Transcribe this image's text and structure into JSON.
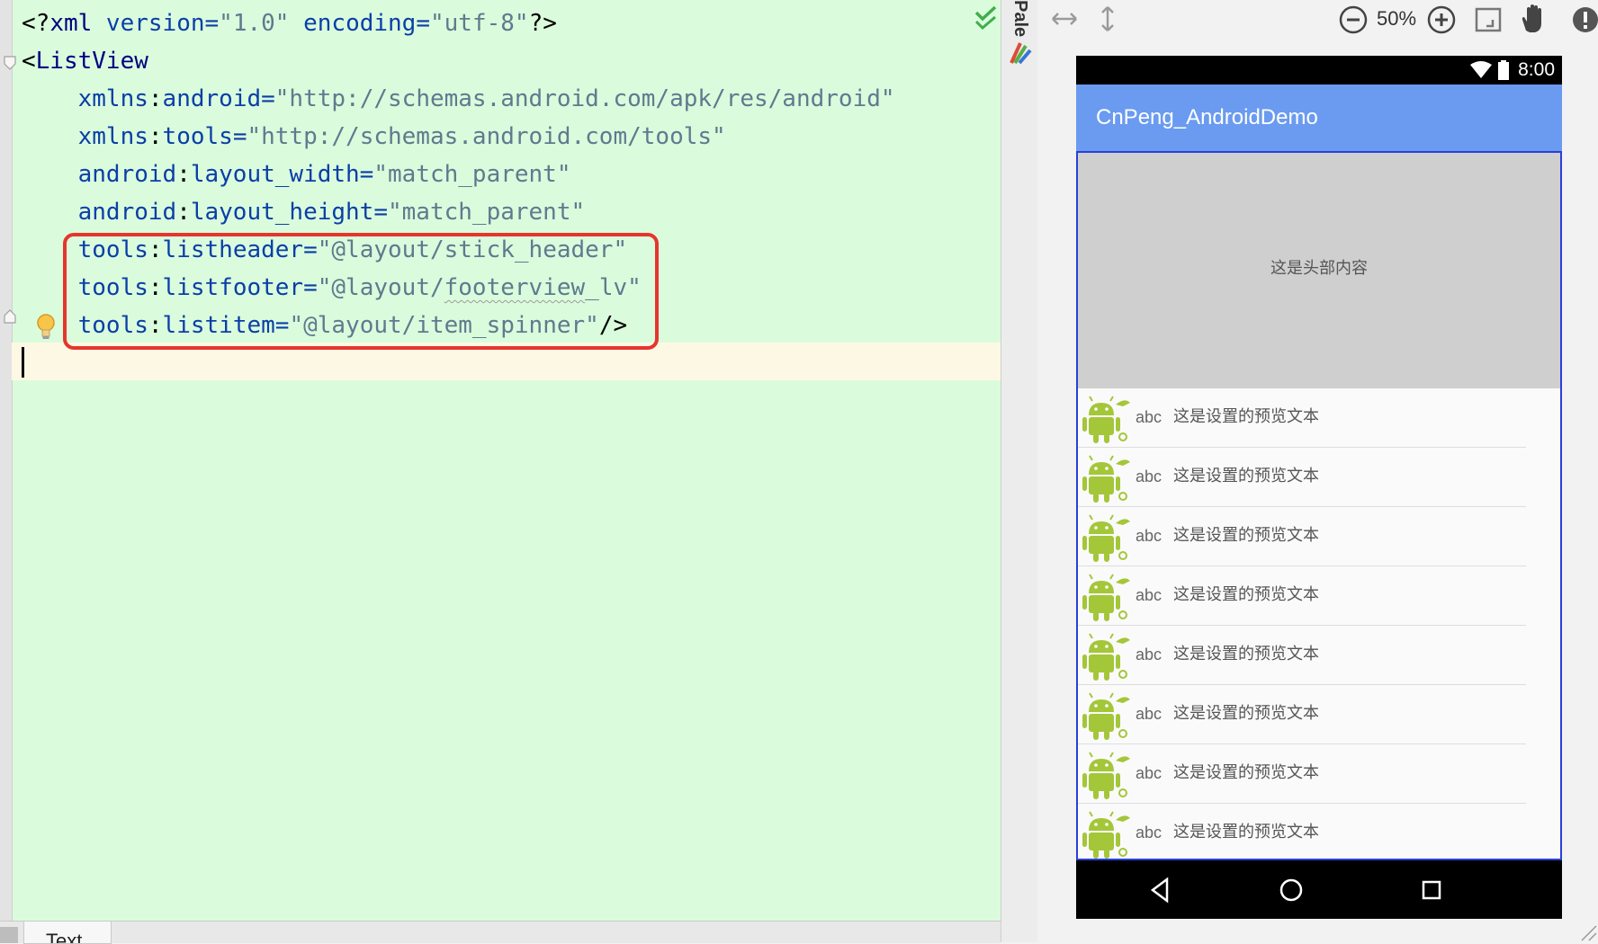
{
  "editor": {
    "lines": [
      [
        {
          "t": "<?",
          "c": "punc"
        },
        {
          "t": "xml",
          "c": "tag"
        },
        {
          "t": " version=",
          "c": "attr"
        },
        {
          "t": "\"1.0\"",
          "c": "val"
        },
        {
          "t": " encoding=",
          "c": "attr"
        },
        {
          "t": "\"utf-8\"",
          "c": "val"
        },
        {
          "t": "?>",
          "c": "punc"
        }
      ],
      [
        {
          "t": "<",
          "c": "punc"
        },
        {
          "t": "ListView",
          "c": "tag"
        }
      ],
      [
        {
          "t": "    xmlns",
          "c": "ns"
        },
        {
          "t": ":",
          "c": "punc"
        },
        {
          "t": "android=",
          "c": "attr"
        },
        {
          "t": "\"http://schemas.android.com/apk/res/android\"",
          "c": "val"
        }
      ],
      [
        {
          "t": "    xmlns",
          "c": "ns"
        },
        {
          "t": ":",
          "c": "punc"
        },
        {
          "t": "tools=",
          "c": "attr"
        },
        {
          "t": "\"http://schemas.android.com/tools\"",
          "c": "val"
        }
      ],
      [
        {
          "t": "    android",
          "c": "ns"
        },
        {
          "t": ":",
          "c": "punc"
        },
        {
          "t": "layout_width=",
          "c": "attr"
        },
        {
          "t": "\"match_parent\"",
          "c": "val"
        }
      ],
      [
        {
          "t": "    android",
          "c": "ns"
        },
        {
          "t": ":",
          "c": "punc"
        },
        {
          "t": "layout_height=",
          "c": "attr"
        },
        {
          "t": "\"match_parent\"",
          "c": "val"
        }
      ],
      [
        {
          "t": "    tools",
          "c": "ns"
        },
        {
          "t": ":",
          "c": "punc"
        },
        {
          "t": "listheader=",
          "c": "attr"
        },
        {
          "t": "\"@layout/stick_header\"",
          "c": "val"
        }
      ],
      [
        {
          "t": "    tools",
          "c": "ns"
        },
        {
          "t": ":",
          "c": "punc"
        },
        {
          "t": "listfooter=",
          "c": "attr"
        },
        {
          "t": "\"@layout/",
          "c": "val"
        },
        {
          "t": "footerview",
          "c": "val squiggle"
        },
        {
          "t": "_lv\"",
          "c": "val"
        }
      ],
      [
        {
          "t": "    tools",
          "c": "ns"
        },
        {
          "t": ":",
          "c": "punc"
        },
        {
          "t": "listitem=",
          "c": "attr"
        },
        {
          "t": "\"@layout/item_spinner\"",
          "c": "val"
        },
        {
          "t": "/>",
          "c": "punc"
        }
      ]
    ],
    "bottom_tab_label": "Text"
  },
  "palette": {
    "label": "Pale"
  },
  "preview_toolbar": {
    "zoom_label": "50%"
  },
  "device": {
    "status_time": "8:00",
    "app_title": "CnPeng_AndroidDemo",
    "header_text": "这是头部内容",
    "items": [
      {
        "abc": "abc",
        "text": "这是设置的预览文本"
      },
      {
        "abc": "abc",
        "text": "这是设置的预览文本"
      },
      {
        "abc": "abc",
        "text": "这是设置的预览文本"
      },
      {
        "abc": "abc",
        "text": "这是设置的预览文本"
      },
      {
        "abc": "abc",
        "text": "这是设置的预览文本"
      },
      {
        "abc": "abc",
        "text": "这是设置的预览文本"
      },
      {
        "abc": "abc",
        "text": "这是设置的预览文本"
      },
      {
        "abc": "abc",
        "text": "这是设置的预览文本"
      }
    ]
  },
  "colors": {
    "editor_bg": "#dafcdc",
    "highlight_box": "#e6352d",
    "app_bar": "#6a9bf0",
    "listview_border": "#2a3fd9",
    "android_green": "#a4c639"
  },
  "icons": [
    "check-icon",
    "fold-icon",
    "bulb-icon",
    "palette-icon",
    "horizontal-arrows-icon",
    "vertical-arrows-icon",
    "zoom-out-icon",
    "zoom-in-icon",
    "fit-screen-icon",
    "hand-pan-icon",
    "warning-icon",
    "wifi-icon",
    "battery-icon",
    "android-robot-icon",
    "back-icon",
    "home-icon",
    "recents-icon"
  ]
}
